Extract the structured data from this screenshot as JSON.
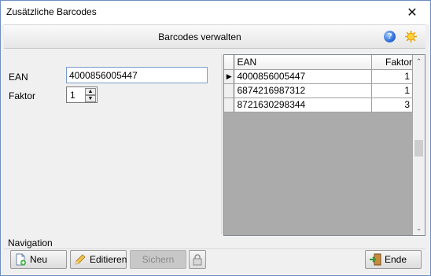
{
  "window": {
    "title": "Zusätzliche Barcodes",
    "close_label": "✕"
  },
  "header": {
    "title": "Barcodes verwalten",
    "help_icon": "help-icon",
    "settings_icon": "sun-icon"
  },
  "form": {
    "ean_label": "EAN",
    "ean_value": "4000856005447",
    "faktor_label": "Faktor",
    "faktor_value": "1"
  },
  "grid": {
    "columns": [
      "EAN",
      "Faktor"
    ],
    "rows": [
      {
        "ean": "4000856005447",
        "faktor": "1",
        "current": true
      },
      {
        "ean": "6874216987312",
        "faktor": "1",
        "current": false
      },
      {
        "ean": "8721630298344",
        "faktor": "3",
        "current": false
      }
    ]
  },
  "navigation": {
    "label": "Navigation",
    "new_label": "Neu",
    "edit_label": "Editieren",
    "save_label": "Sichern",
    "exit_label": "Ende"
  },
  "colors": {
    "border": "#6d8ebf",
    "input_border": "#7a9ccc",
    "disabled_button": "#c8c8c8"
  }
}
